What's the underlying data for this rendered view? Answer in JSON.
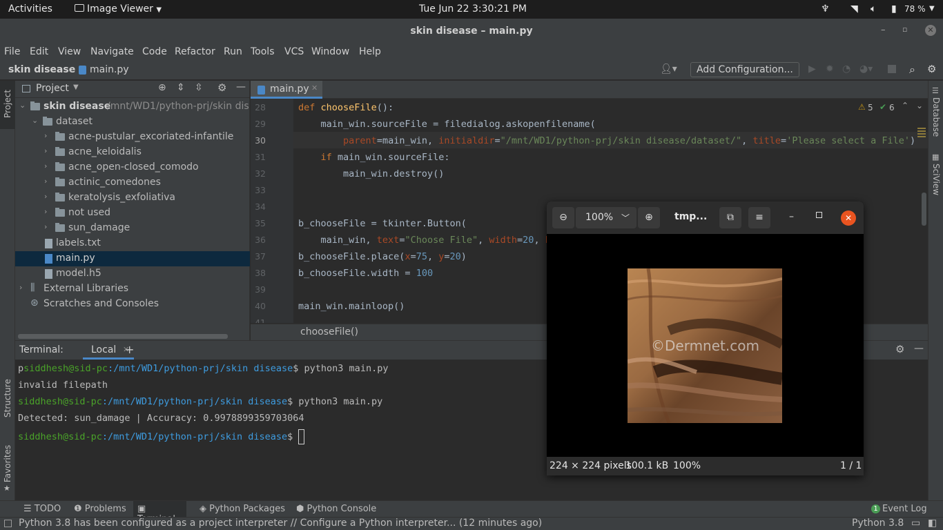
{
  "topbar": {
    "activities": "Activities",
    "app_menu": "Image Viewer",
    "clock": "Tue Jun 22   3:30:21 PM",
    "battery": "78 %"
  },
  "window": {
    "title": "skin disease – main.py"
  },
  "menu": [
    "File",
    "Edit",
    "View",
    "Navigate",
    "Code",
    "Refactor",
    "Run",
    "Tools",
    "VCS",
    "Window",
    "Help"
  ],
  "navbar": {
    "project": "skin disease",
    "file": "main.py",
    "add_config": "Add Configuration..."
  },
  "sidebars": {
    "project": "Project",
    "structure": "Structure",
    "favorites": "Favorites",
    "database": "Database",
    "sciview": "SciView"
  },
  "project_panel": {
    "title": "Project",
    "root_name": "skin disease",
    "root_path": "/mnt/WD1/python-prj/skin dis",
    "dataset": "dataset",
    "folders": [
      "acne-pustular_excoriated-infantile",
      "acne_keloidalis",
      "acne_open-closed_comodo",
      "actinic_comedones",
      "keratolysis_exfoliativa",
      "not used",
      "sun_damage"
    ],
    "files": [
      "labels.txt",
      "main.py",
      "model.h5"
    ],
    "external": "External Libraries",
    "scratches": "Scratches and Consoles"
  },
  "editor": {
    "tab": "main.py",
    "warnings": "5",
    "checks": "6",
    "line_numbers": [
      "28",
      "29",
      "30",
      "31",
      "32",
      "33",
      "34",
      "35",
      "36",
      "37",
      "38",
      "39",
      "40",
      "41"
    ],
    "breadcrumb": "chooseFile()"
  },
  "terminal": {
    "label": "Terminal:",
    "tab": "Local",
    "lines": {
      "l1_prefix": "p",
      "user": "siddhesh@sid-pc",
      "path": ":/mnt/WD1/python-prj/skin disease",
      "cmd": "$ python3 main.py",
      "l2": "invalid filepath",
      "l4": "Detected: sun_damage | Accuracy: 0.9978899359703064",
      "prompt_end": "$ "
    }
  },
  "toolwindows": [
    "TODO",
    "Problems",
    "Terminal",
    "Python Packages",
    "Python Console"
  ],
  "event_log": "Event Log",
  "event_count": "1",
  "status": {
    "message": "Python 3.8 has been configured as a project interpreter // Configure a Python interpreter... (12 minutes ago)",
    "interpreter": "Python 3.8"
  },
  "viewer": {
    "zoom": "100%",
    "title": "tmp...",
    "watermark": "©Dermnet.com",
    "footer_size": "224 × 224 pixels",
    "footer_bytes": "100.1 kB",
    "footer_zoom": "100%",
    "footer_page": "1 / 1"
  }
}
